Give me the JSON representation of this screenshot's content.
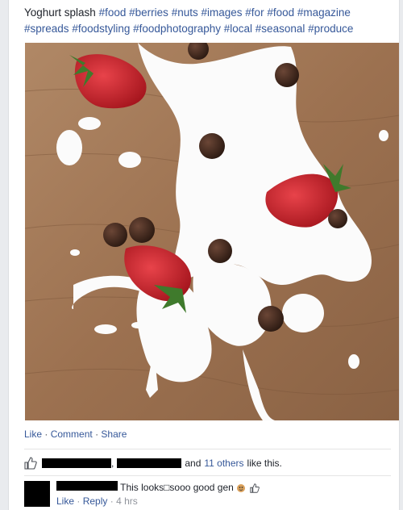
{
  "post": {
    "caption_text": "Yoghurt splash",
    "hashtags": [
      "#food",
      "#berries",
      "#nuts",
      "#images",
      "#for",
      "#food",
      "#magazine",
      "#spreads",
      "#foodstyling",
      "#foodphotography",
      "#local",
      "#seasonal",
      "#produce"
    ]
  },
  "actions": {
    "like": "Like",
    "comment": "Comment",
    "share": "Share",
    "sep": "·"
  },
  "likes": {
    "comma": ",",
    "and_text": "and",
    "others": "11 others",
    "suffix": "like this."
  },
  "comment": {
    "text": "This looks□sooo good gen",
    "like": "Like",
    "reply": "Reply",
    "time": "4 hrs",
    "sep": "·"
  },
  "colors": {
    "link": "#365899",
    "meta": "#90949c",
    "redaction": "#000000"
  }
}
